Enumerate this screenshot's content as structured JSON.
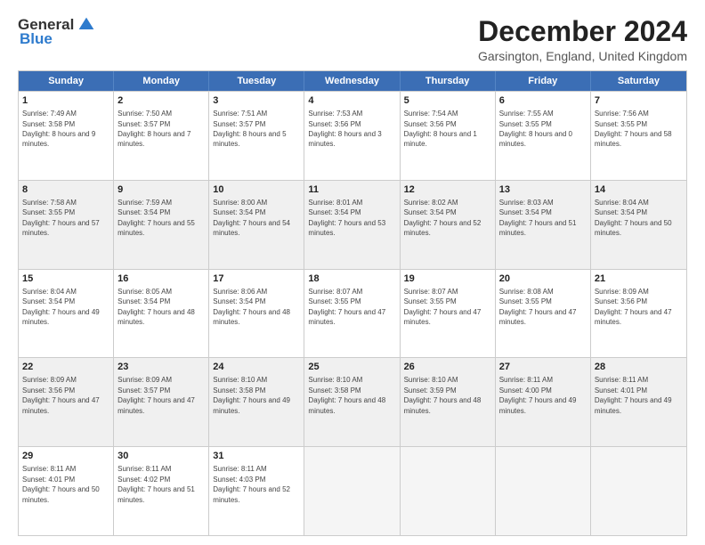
{
  "logo": {
    "general": "General",
    "blue": "Blue"
  },
  "title": "December 2024",
  "subtitle": "Garsington, England, United Kingdom",
  "days": [
    "Sunday",
    "Monday",
    "Tuesday",
    "Wednesday",
    "Thursday",
    "Friday",
    "Saturday"
  ],
  "weeks": [
    [
      {
        "day": 1,
        "sunrise": "7:49 AM",
        "sunset": "3:58 PM",
        "daylight": "8 hours and 9 minutes."
      },
      {
        "day": 2,
        "sunrise": "7:50 AM",
        "sunset": "3:57 PM",
        "daylight": "8 hours and 7 minutes."
      },
      {
        "day": 3,
        "sunrise": "7:51 AM",
        "sunset": "3:57 PM",
        "daylight": "8 hours and 5 minutes."
      },
      {
        "day": 4,
        "sunrise": "7:53 AM",
        "sunset": "3:56 PM",
        "daylight": "8 hours and 3 minutes."
      },
      {
        "day": 5,
        "sunrise": "7:54 AM",
        "sunset": "3:56 PM",
        "daylight": "8 hours and 1 minute."
      },
      {
        "day": 6,
        "sunrise": "7:55 AM",
        "sunset": "3:55 PM",
        "daylight": "8 hours and 0 minutes."
      },
      {
        "day": 7,
        "sunrise": "7:56 AM",
        "sunset": "3:55 PM",
        "daylight": "7 hours and 58 minutes."
      }
    ],
    [
      {
        "day": 8,
        "sunrise": "7:58 AM",
        "sunset": "3:55 PM",
        "daylight": "7 hours and 57 minutes."
      },
      {
        "day": 9,
        "sunrise": "7:59 AM",
        "sunset": "3:54 PM",
        "daylight": "7 hours and 55 minutes."
      },
      {
        "day": 10,
        "sunrise": "8:00 AM",
        "sunset": "3:54 PM",
        "daylight": "7 hours and 54 minutes."
      },
      {
        "day": 11,
        "sunrise": "8:01 AM",
        "sunset": "3:54 PM",
        "daylight": "7 hours and 53 minutes."
      },
      {
        "day": 12,
        "sunrise": "8:02 AM",
        "sunset": "3:54 PM",
        "daylight": "7 hours and 52 minutes."
      },
      {
        "day": 13,
        "sunrise": "8:03 AM",
        "sunset": "3:54 PM",
        "daylight": "7 hours and 51 minutes."
      },
      {
        "day": 14,
        "sunrise": "8:04 AM",
        "sunset": "3:54 PM",
        "daylight": "7 hours and 50 minutes."
      }
    ],
    [
      {
        "day": 15,
        "sunrise": "8:04 AM",
        "sunset": "3:54 PM",
        "daylight": "7 hours and 49 minutes."
      },
      {
        "day": 16,
        "sunrise": "8:05 AM",
        "sunset": "3:54 PM",
        "daylight": "7 hours and 48 minutes."
      },
      {
        "day": 17,
        "sunrise": "8:06 AM",
        "sunset": "3:54 PM",
        "daylight": "7 hours and 48 minutes."
      },
      {
        "day": 18,
        "sunrise": "8:07 AM",
        "sunset": "3:55 PM",
        "daylight": "7 hours and 47 minutes."
      },
      {
        "day": 19,
        "sunrise": "8:07 AM",
        "sunset": "3:55 PM",
        "daylight": "7 hours and 47 minutes."
      },
      {
        "day": 20,
        "sunrise": "8:08 AM",
        "sunset": "3:55 PM",
        "daylight": "7 hours and 47 minutes."
      },
      {
        "day": 21,
        "sunrise": "8:09 AM",
        "sunset": "3:56 PM",
        "daylight": "7 hours and 47 minutes."
      }
    ],
    [
      {
        "day": 22,
        "sunrise": "8:09 AM",
        "sunset": "3:56 PM",
        "daylight": "7 hours and 47 minutes."
      },
      {
        "day": 23,
        "sunrise": "8:09 AM",
        "sunset": "3:57 PM",
        "daylight": "7 hours and 47 minutes."
      },
      {
        "day": 24,
        "sunrise": "8:10 AM",
        "sunset": "3:58 PM",
        "daylight": "7 hours and 49 minutes."
      },
      {
        "day": 25,
        "sunrise": "8:10 AM",
        "sunset": "3:58 PM",
        "daylight": "7 hours and 48 minutes."
      },
      {
        "day": 26,
        "sunrise": "8:10 AM",
        "sunset": "3:59 PM",
        "daylight": "7 hours and 48 minutes."
      },
      {
        "day": 27,
        "sunrise": "8:11 AM",
        "sunset": "4:00 PM",
        "daylight": "7 hours and 49 minutes."
      },
      {
        "day": 28,
        "sunrise": "8:11 AM",
        "sunset": "4:01 PM",
        "daylight": "7 hours and 49 minutes."
      }
    ],
    [
      {
        "day": 29,
        "sunrise": "8:11 AM",
        "sunset": "4:01 PM",
        "daylight": "7 hours and 50 minutes."
      },
      {
        "day": 30,
        "sunrise": "8:11 AM",
        "sunset": "4:02 PM",
        "daylight": "7 hours and 51 minutes."
      },
      {
        "day": 31,
        "sunrise": "8:11 AM",
        "sunset": "4:03 PM",
        "daylight": "7 hours and 52 minutes."
      },
      null,
      null,
      null,
      null
    ]
  ]
}
